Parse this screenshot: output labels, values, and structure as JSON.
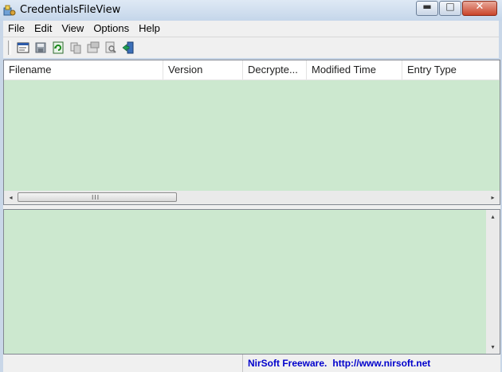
{
  "window": {
    "title": "CredentialsFileView",
    "controls": {
      "minimize": "▬",
      "maximize": "□",
      "close": "✕"
    }
  },
  "menubar": {
    "items": [
      "File",
      "Edit",
      "View",
      "Options",
      "Help"
    ]
  },
  "toolbar": {
    "buttons": [
      "window-icon",
      "save-icon",
      "refresh-icon",
      "copy-icon",
      "properties-icon",
      "find-icon",
      "exit-icon"
    ]
  },
  "listview": {
    "columns": [
      "Filename",
      "Version",
      "Decrypte...",
      "Modified Time",
      "Entry Type"
    ],
    "rows": [],
    "scroll": {
      "left_arrow": "◂",
      "right_arrow": "▸",
      "grip": "III"
    }
  },
  "lowerpane": {
    "content": [],
    "scroll": {
      "up_arrow": "▴",
      "down_arrow": "▾"
    }
  },
  "statusbar": {
    "vendor": "NirSoft Freeware.",
    "url": "http://www.nirsoft.net"
  },
  "colors": {
    "pane_bg": "#cce8cf",
    "link": "#0000cc",
    "chrome": "#f0f0f0"
  }
}
